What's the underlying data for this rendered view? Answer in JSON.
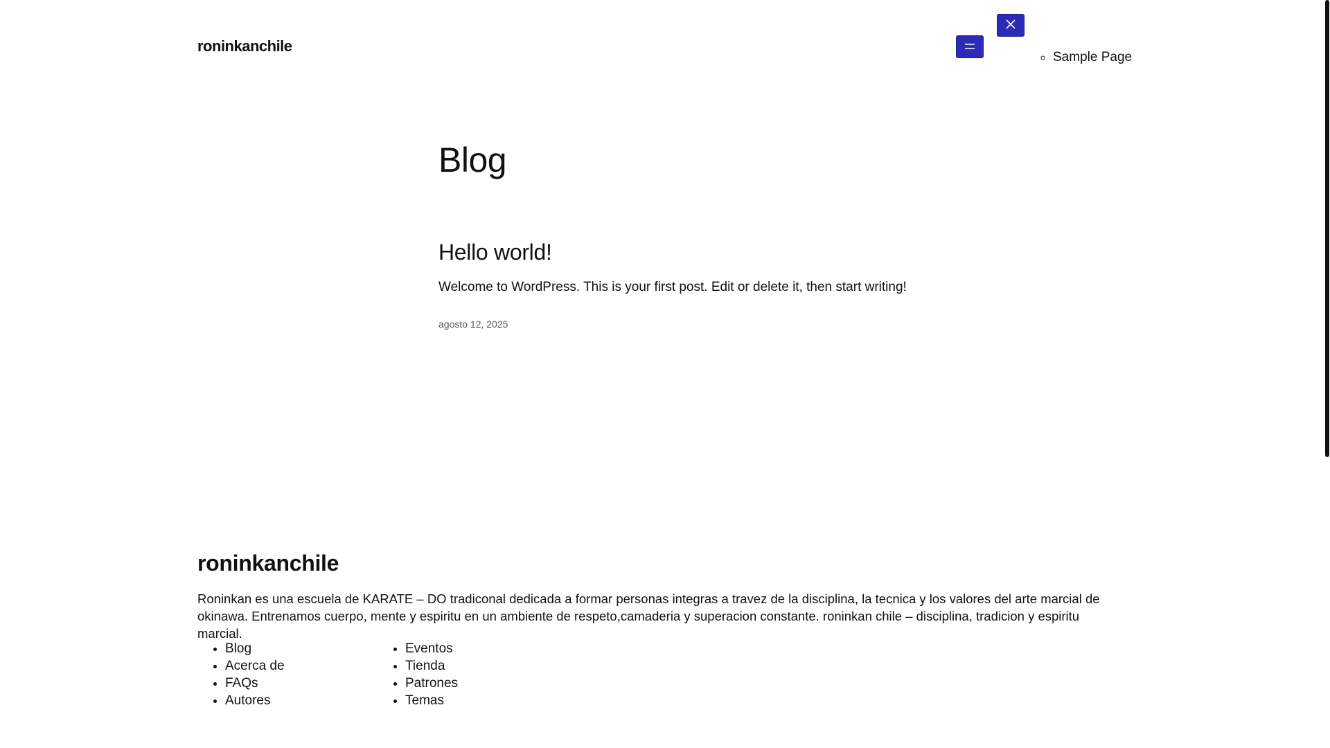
{
  "header": {
    "site_title": "roninkanchile",
    "menu_open_icon": "hamburger-icon",
    "menu_close_icon": "close-icon",
    "submenu": [
      "Sample Page"
    ],
    "accent_color": "#2b2bb8"
  },
  "main": {
    "page_title": "Blog",
    "posts": [
      {
        "title": "Hello world!",
        "excerpt": "Welcome to WordPress. This is your first post. Edit or delete it, then start writing!",
        "date": "agosto 12, 2025"
      }
    ]
  },
  "footer": {
    "site_title": "roninkanchile",
    "description": "Roninkan es una escuela de KARATE – DO tradiconal dedicada a formar personas integras a travez de la disciplina, la tecnica y los valores del arte marcial de okinawa. Entrenamos cuerpo, mente y espiritu en un ambiente de respeto,camaderia y superacion constante. roninkan chile – disciplina, tradicion y espiritu marcial.",
    "links_col1": [
      "Blog",
      "Acerca de",
      "FAQs",
      "Autores"
    ],
    "links_col2": [
      "Eventos",
      "Tienda",
      "Patrones",
      "Temas"
    ]
  }
}
